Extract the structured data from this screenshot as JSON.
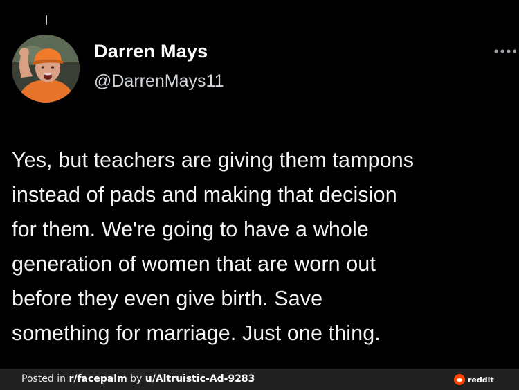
{
  "post": {
    "display_name": "Darren Mays",
    "handle": "@DarrenMays11",
    "text": "Yes, but teachers are giving them tampons\ninstead of pads and making that decision\nfor them. We're going to have a whole\ngeneration of women that are worn out\nbefore they even give birth.  Save\nsomething for marriage. Just one thing."
  },
  "footer": {
    "prefix": "Posted in ",
    "subreddit": "r/facepalm",
    "by": " by ",
    "username": "u/Altruistic-Ad-9283",
    "brand": "reddit"
  },
  "icons": {
    "more": "more-horizontal-icon",
    "avatar": "avatar",
    "reddit": "reddit-logo-icon"
  },
  "colors": {
    "background": "#000000",
    "text": "#f2f4f5",
    "handle": "#d2d6da",
    "footer_bar": "#212121",
    "reddit_orange": "#ff4500"
  }
}
